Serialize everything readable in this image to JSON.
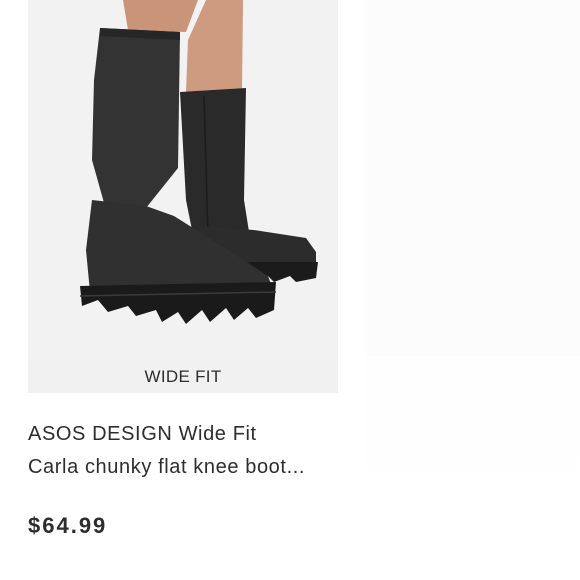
{
  "product": {
    "badge": "WIDE FIT",
    "title_line1": "ASOS DESIGN Wide Fit",
    "title_line2": "Carla chunky flat knee boot...",
    "price": "$64.99"
  },
  "image": {
    "icon": "knee-boots-photo",
    "background_color": "#f2f2f2",
    "boot_color": "#2f2f2f",
    "skin_color": "#c99478"
  }
}
